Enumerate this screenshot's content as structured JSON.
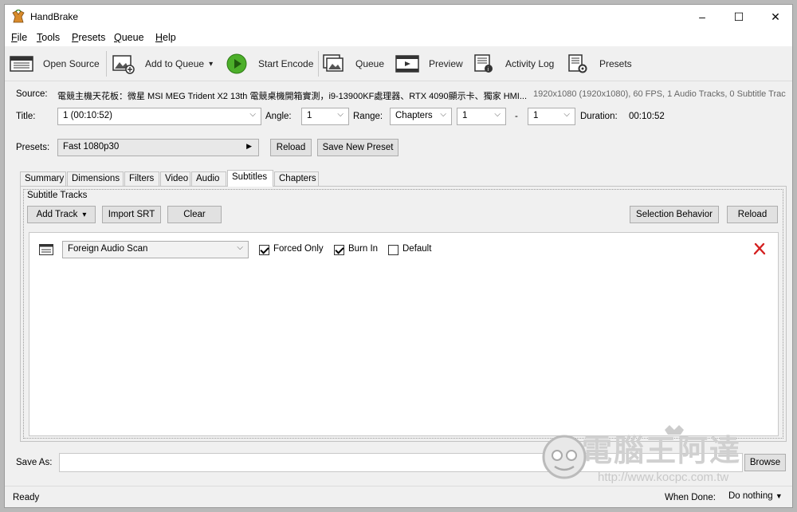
{
  "window": {
    "title": "HandBrake",
    "controls": {
      "minimize": "–",
      "maximize": "☐",
      "close": "✕"
    }
  },
  "menu": [
    {
      "accel": "F",
      "rest": "ile"
    },
    {
      "accel": "T",
      "rest": "ools"
    },
    {
      "accel": "P",
      "rest": "resets"
    },
    {
      "accel": "Q",
      "rest": "ueue"
    },
    {
      "accel": "H",
      "rest": "elp"
    }
  ],
  "toolbar": {
    "open_source": "Open Source",
    "add_to_queue": "Add to Queue",
    "add_to_queue_arrow": "▾",
    "start_encode": "Start Encode",
    "queue": "Queue",
    "preview": "Preview",
    "activity_log": "Activity Log",
    "presets": "Presets"
  },
  "source": {
    "label": "Source:",
    "name": "電競主機天花板：微星 MSI MEG Trident X2 13th 電競桌機開箱實測，i9-13900KF處理器、RTX 4090顯示卡、獨家 HMI...",
    "info": "1920x1080 (1920x1080), 60 FPS, 1 Audio Tracks, 0 Subtitle Trac"
  },
  "title_row": {
    "title_label": "Title:",
    "title_value": "1 (00:10:52)",
    "angle_label": "Angle:",
    "angle_value": "1",
    "range_label": "Range:",
    "range_type": "Chapters",
    "range_start": "1",
    "range_dash": "-",
    "range_end": "1",
    "duration_label": "Duration:",
    "duration_value": "00:10:52"
  },
  "presets_row": {
    "label": "Presets:",
    "value": "Fast 1080p30",
    "reload": "Reload",
    "save_new": "Save New Preset"
  },
  "tabs": [
    "Summary",
    "Dimensions",
    "Filters",
    "Video",
    "Audio",
    "Subtitles",
    "Chapters"
  ],
  "active_tab": "Subtitles",
  "subtitles": {
    "heading": "Subtitle Tracks",
    "add_track": "Add Track",
    "add_track_arrow": "▾",
    "import_srt": "Import SRT",
    "clear": "Clear",
    "selection_behavior": "Selection Behavior",
    "reload": "Reload",
    "track": {
      "source": "Foreign Audio Scan",
      "forced_only_label": "Forced Only",
      "forced_only": true,
      "burn_in_label": "Burn In",
      "burn_in": true,
      "default_label": "Default",
      "default": false
    }
  },
  "save_as": {
    "label": "Save As:",
    "value": "",
    "browse": "Browse"
  },
  "status": {
    "text": "Ready",
    "when_done_label": "When Done:",
    "when_done_value": "Do nothing"
  },
  "watermark": {
    "brand": "電腦王阿達",
    "url": "http://www.kocpc.com.tw"
  },
  "colors": {
    "play_green": "#4caf2a",
    "remove_red": "#d42020"
  }
}
